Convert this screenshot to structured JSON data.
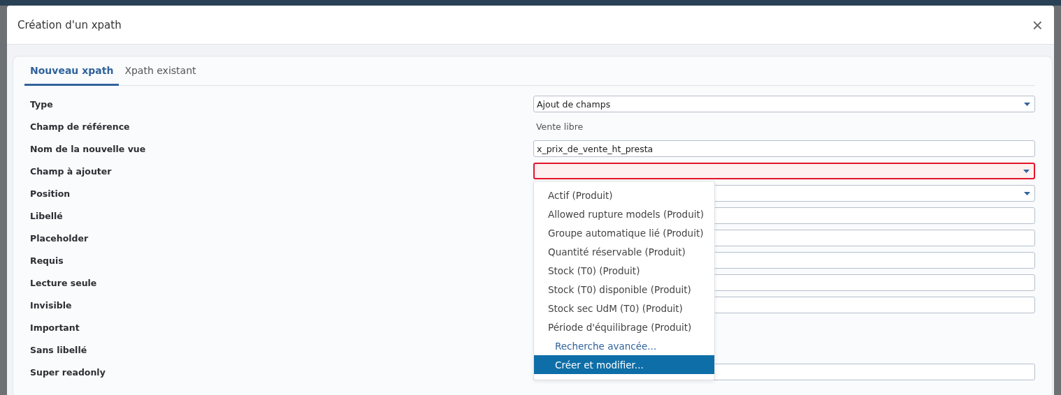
{
  "dialog": {
    "title": "Création d'un xpath",
    "close": "×"
  },
  "tabs": [
    {
      "label": "Nouveau xpath",
      "selected": true
    },
    {
      "label": "Xpath existant",
      "selected": false
    }
  ],
  "fields": [
    {
      "label": "Type",
      "kind": "select",
      "value": "Ajout de champs",
      "invalid": false
    },
    {
      "label": "Champ de référence",
      "kind": "text",
      "value": "Vente libre"
    },
    {
      "label": "Nom de la nouvelle vue",
      "kind": "input",
      "value": "x_prix_de_vente_ht_presta"
    },
    {
      "label": "Champ à ajouter",
      "kind": "select",
      "invalid": true,
      "options": [
        {
          "label": "Actif (Produit)",
          "kind": "option",
          "selected": false
        },
        {
          "label": "Allowed rupture models (Produit)",
          "kind": "option",
          "selected": false
        },
        {
          "label": "Groupe automatique lié (Produit)",
          "kind": "option",
          "selected": false
        },
        {
          "label": "Quantité réservable (Produit)",
          "kind": "option",
          "selected": false
        },
        {
          "label": "Stock (T0) (Produit)",
          "kind": "option",
          "selected": false
        },
        {
          "label": "Stock (T0) disponible (Produit)",
          "kind": "option",
          "selected": false
        },
        {
          "label": "Stock sec UdM (T0) (Produit)",
          "kind": "option",
          "selected": false
        },
        {
          "label": "Période d'équilibrage (Produit)",
          "kind": "option",
          "selected": false
        },
        {
          "label": "Recherche avancée...",
          "kind": "link",
          "selected": false
        },
        {
          "label": "Créer et modifier...",
          "kind": "action",
          "selected": true
        }
      ]
    },
    {
      "label": "Position",
      "kind": "select",
      "invalid": false
    },
    {
      "label": "Libellé",
      "kind": "input"
    },
    {
      "label": "Placeholder",
      "kind": "input"
    },
    {
      "label": "Requis",
      "kind": "input"
    },
    {
      "label": "Lecture seule",
      "kind": "input"
    },
    {
      "label": "Invisible",
      "kind": "input"
    },
    {
      "label": "Important",
      "kind": "blank"
    },
    {
      "label": "Sans libellé",
      "kind": "blank"
    },
    {
      "label": "Super readonly",
      "kind": "input"
    }
  ]
}
